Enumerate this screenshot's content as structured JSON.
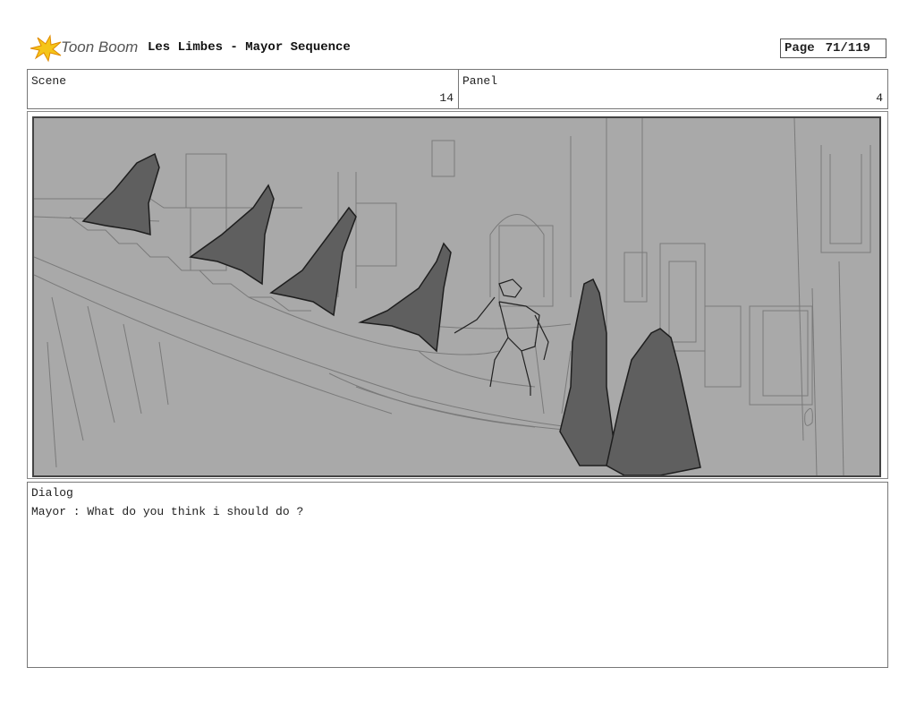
{
  "header": {
    "logo_text": "Toon Boom",
    "title": "Les Limbes - Mayor Sequence",
    "page_label": "Page",
    "page_number": "71/119"
  },
  "scene": {
    "label": "Scene",
    "value": "14"
  },
  "panel": {
    "label": "Panel",
    "value": "4"
  },
  "dialog": {
    "label": "Dialog",
    "text": "Mayor : What do you think i should do ?"
  },
  "colors": {
    "sketch_background": "#a9a9a9",
    "shadow_fill": "#5f5f5f",
    "logo_accent": "#f5c518"
  }
}
